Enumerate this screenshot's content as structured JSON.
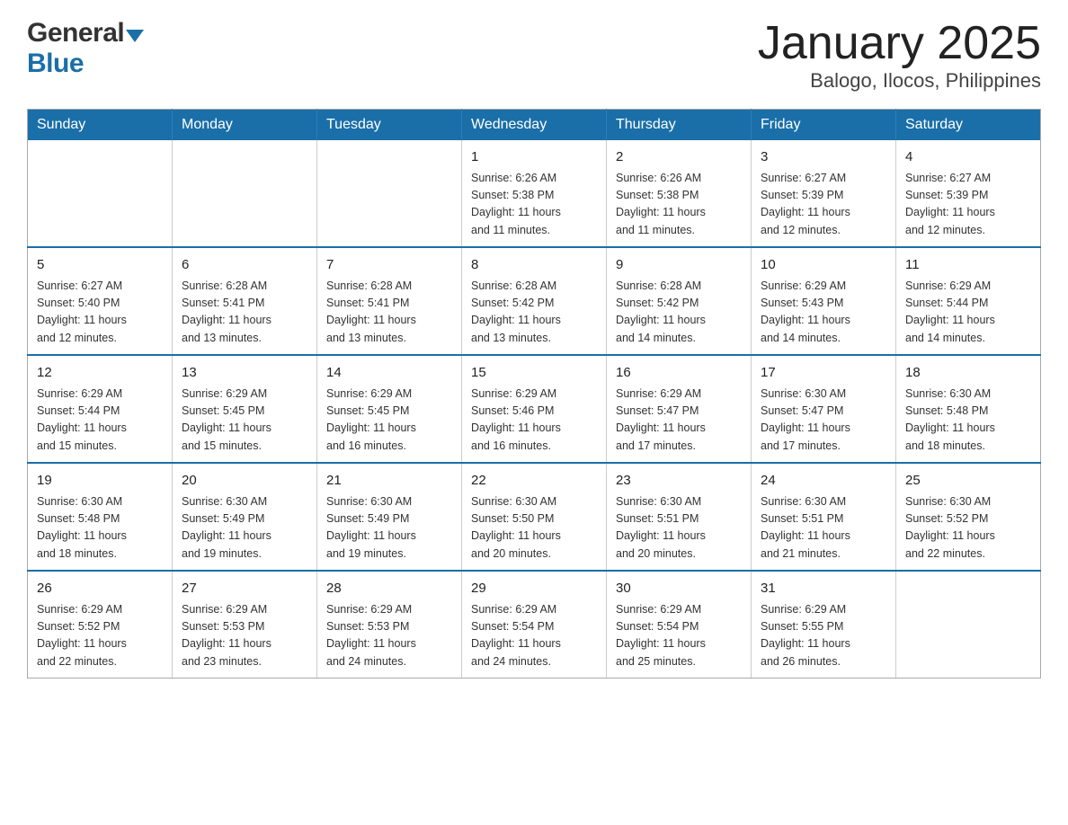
{
  "logo": {
    "general": "General",
    "blue": "Blue"
  },
  "title": "January 2025",
  "subtitle": "Balogo, Ilocos, Philippines",
  "days": [
    "Sunday",
    "Monday",
    "Tuesday",
    "Wednesday",
    "Thursday",
    "Friday",
    "Saturday"
  ],
  "weeks": [
    [
      {
        "day": "",
        "info": ""
      },
      {
        "day": "",
        "info": ""
      },
      {
        "day": "",
        "info": ""
      },
      {
        "day": "1",
        "info": "Sunrise: 6:26 AM\nSunset: 5:38 PM\nDaylight: 11 hours\nand 11 minutes."
      },
      {
        "day": "2",
        "info": "Sunrise: 6:26 AM\nSunset: 5:38 PM\nDaylight: 11 hours\nand 11 minutes."
      },
      {
        "day": "3",
        "info": "Sunrise: 6:27 AM\nSunset: 5:39 PM\nDaylight: 11 hours\nand 12 minutes."
      },
      {
        "day": "4",
        "info": "Sunrise: 6:27 AM\nSunset: 5:39 PM\nDaylight: 11 hours\nand 12 minutes."
      }
    ],
    [
      {
        "day": "5",
        "info": "Sunrise: 6:27 AM\nSunset: 5:40 PM\nDaylight: 11 hours\nand 12 minutes."
      },
      {
        "day": "6",
        "info": "Sunrise: 6:28 AM\nSunset: 5:41 PM\nDaylight: 11 hours\nand 13 minutes."
      },
      {
        "day": "7",
        "info": "Sunrise: 6:28 AM\nSunset: 5:41 PM\nDaylight: 11 hours\nand 13 minutes."
      },
      {
        "day": "8",
        "info": "Sunrise: 6:28 AM\nSunset: 5:42 PM\nDaylight: 11 hours\nand 13 minutes."
      },
      {
        "day": "9",
        "info": "Sunrise: 6:28 AM\nSunset: 5:42 PM\nDaylight: 11 hours\nand 14 minutes."
      },
      {
        "day": "10",
        "info": "Sunrise: 6:29 AM\nSunset: 5:43 PM\nDaylight: 11 hours\nand 14 minutes."
      },
      {
        "day": "11",
        "info": "Sunrise: 6:29 AM\nSunset: 5:44 PM\nDaylight: 11 hours\nand 14 minutes."
      }
    ],
    [
      {
        "day": "12",
        "info": "Sunrise: 6:29 AM\nSunset: 5:44 PM\nDaylight: 11 hours\nand 15 minutes."
      },
      {
        "day": "13",
        "info": "Sunrise: 6:29 AM\nSunset: 5:45 PM\nDaylight: 11 hours\nand 15 minutes."
      },
      {
        "day": "14",
        "info": "Sunrise: 6:29 AM\nSunset: 5:45 PM\nDaylight: 11 hours\nand 16 minutes."
      },
      {
        "day": "15",
        "info": "Sunrise: 6:29 AM\nSunset: 5:46 PM\nDaylight: 11 hours\nand 16 minutes."
      },
      {
        "day": "16",
        "info": "Sunrise: 6:29 AM\nSunset: 5:47 PM\nDaylight: 11 hours\nand 17 minutes."
      },
      {
        "day": "17",
        "info": "Sunrise: 6:30 AM\nSunset: 5:47 PM\nDaylight: 11 hours\nand 17 minutes."
      },
      {
        "day": "18",
        "info": "Sunrise: 6:30 AM\nSunset: 5:48 PM\nDaylight: 11 hours\nand 18 minutes."
      }
    ],
    [
      {
        "day": "19",
        "info": "Sunrise: 6:30 AM\nSunset: 5:48 PM\nDaylight: 11 hours\nand 18 minutes."
      },
      {
        "day": "20",
        "info": "Sunrise: 6:30 AM\nSunset: 5:49 PM\nDaylight: 11 hours\nand 19 minutes."
      },
      {
        "day": "21",
        "info": "Sunrise: 6:30 AM\nSunset: 5:49 PM\nDaylight: 11 hours\nand 19 minutes."
      },
      {
        "day": "22",
        "info": "Sunrise: 6:30 AM\nSunset: 5:50 PM\nDaylight: 11 hours\nand 20 minutes."
      },
      {
        "day": "23",
        "info": "Sunrise: 6:30 AM\nSunset: 5:51 PM\nDaylight: 11 hours\nand 20 minutes."
      },
      {
        "day": "24",
        "info": "Sunrise: 6:30 AM\nSunset: 5:51 PM\nDaylight: 11 hours\nand 21 minutes."
      },
      {
        "day": "25",
        "info": "Sunrise: 6:30 AM\nSunset: 5:52 PM\nDaylight: 11 hours\nand 22 minutes."
      }
    ],
    [
      {
        "day": "26",
        "info": "Sunrise: 6:29 AM\nSunset: 5:52 PM\nDaylight: 11 hours\nand 22 minutes."
      },
      {
        "day": "27",
        "info": "Sunrise: 6:29 AM\nSunset: 5:53 PM\nDaylight: 11 hours\nand 23 minutes."
      },
      {
        "day": "28",
        "info": "Sunrise: 6:29 AM\nSunset: 5:53 PM\nDaylight: 11 hours\nand 24 minutes."
      },
      {
        "day": "29",
        "info": "Sunrise: 6:29 AM\nSunset: 5:54 PM\nDaylight: 11 hours\nand 24 minutes."
      },
      {
        "day": "30",
        "info": "Sunrise: 6:29 AM\nSunset: 5:54 PM\nDaylight: 11 hours\nand 25 minutes."
      },
      {
        "day": "31",
        "info": "Sunrise: 6:29 AM\nSunset: 5:55 PM\nDaylight: 11 hours\nand 26 minutes."
      },
      {
        "day": "",
        "info": ""
      }
    ]
  ]
}
